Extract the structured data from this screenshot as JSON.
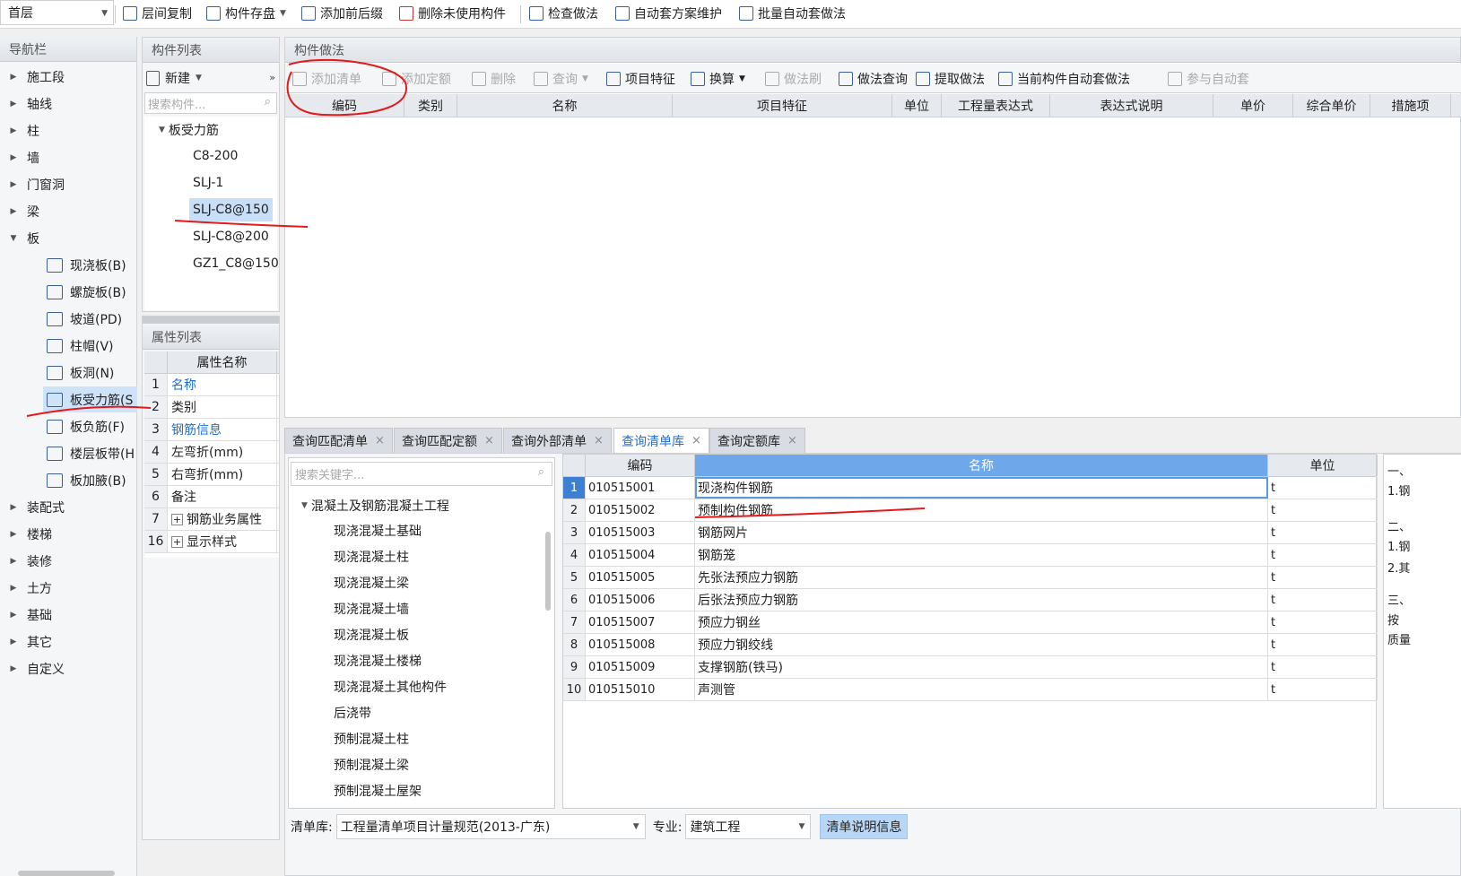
{
  "toolbar": {
    "floor": "首层",
    "items": [
      "层间复制",
      "构件存盘",
      "添加前后缀",
      "删除未使用构件",
      "检查做法",
      "自动套方案维护",
      "批量自动套做法"
    ]
  },
  "nav": {
    "title": "导航栏",
    "items": [
      "施工段",
      "轴线",
      "柱",
      "墙",
      "门窗洞",
      "梁",
      "板"
    ],
    "board_items": [
      "现浇板(B)",
      "螺旋板(B)",
      "坡道(PD)",
      "柱帽(V)",
      "板洞(N)",
      "板受力筋(S",
      "板负筋(F)",
      "楼层板带(H",
      "板加腋(B)"
    ],
    "more": [
      "装配式",
      "楼梯",
      "装修",
      "土方",
      "基础",
      "其它",
      "自定义"
    ]
  },
  "comp": {
    "title": "构件列表",
    "new": "新建",
    "search": "搜索构件...",
    "group": "板受力筋",
    "items": [
      "C8-200",
      "SLJ-1",
      "SLJ-C8@150",
      "SLJ-C8@200",
      "GZ1_C8@150"
    ]
  },
  "attr": {
    "title": "属性列表",
    "header": "属性名称",
    "rows": [
      [
        "1",
        "名称"
      ],
      [
        "2",
        "类别"
      ],
      [
        "3",
        "钢筋信息"
      ],
      [
        "4",
        "左弯折(mm)"
      ],
      [
        "5",
        "右弯折(mm)"
      ],
      [
        "6",
        "备注"
      ],
      [
        "7",
        "钢筋业务属性"
      ],
      [
        "16",
        "显示样式"
      ]
    ]
  },
  "method": {
    "title": "构件做法",
    "tools": [
      "添加清单",
      "添加定额",
      "删除",
      "查询",
      "项目特征",
      "换算",
      "做法刷",
      "做法查询",
      "提取做法",
      "当前构件自动套做法",
      "参与自动套"
    ],
    "cols": [
      "编码",
      "类别",
      "名称",
      "项目特征",
      "单位",
      "工程量表达式",
      "表达式说明",
      "单价",
      "综合单价",
      "措施项"
    ]
  },
  "tabs": [
    "查询匹配清单",
    "查询匹配定额",
    "查询外部清单",
    "查询清单库",
    "查询定额库"
  ],
  "lib": {
    "search": "搜索关键字...",
    "root": "混凝土及钢筋混凝土工程",
    "items": [
      "现浇混凝土基础",
      "现浇混凝土柱",
      "现浇混凝土梁",
      "现浇混凝土墙",
      "现浇混凝土板",
      "现浇混凝土楼梯",
      "现浇混凝土其他构件",
      "后浇带",
      "预制混凝土柱",
      "预制混凝土梁",
      "预制混凝土屋架"
    ]
  },
  "table": {
    "cols": [
      "编码",
      "名称",
      "单位"
    ],
    "rows": [
      [
        "1",
        "010515001",
        "现浇构件钢筋",
        "t"
      ],
      [
        "2",
        "010515002",
        "预制构件钢筋",
        "t"
      ],
      [
        "3",
        "010515003",
        "钢筋网片",
        "t"
      ],
      [
        "4",
        "010515004",
        "钢筋笼",
        "t"
      ],
      [
        "5",
        "010515005",
        "先张法预应力钢筋",
        "t"
      ],
      [
        "6",
        "010515006",
        "后张法预应力钢筋",
        "t"
      ],
      [
        "7",
        "010515007",
        "预应力钢丝",
        "t"
      ],
      [
        "8",
        "010515008",
        "预应力钢绞线",
        "t"
      ],
      [
        "9",
        "010515009",
        "支撑钢筋(铁马)",
        "t"
      ],
      [
        "10",
        "010515010",
        "声测管",
        "t"
      ]
    ]
  },
  "side_notes": [
    "一、",
    "1.钢",
    "二、",
    "1.钢",
    "2.其",
    "三、",
    "按",
    "质量"
  ],
  "bottom": {
    "lib_label": "清单库:",
    "lib_value": "工程量清单项目计量规范(2013-广东)",
    "spec_label": "专业:",
    "spec_value": "建筑工程",
    "info_btn": "清单说明信息"
  }
}
